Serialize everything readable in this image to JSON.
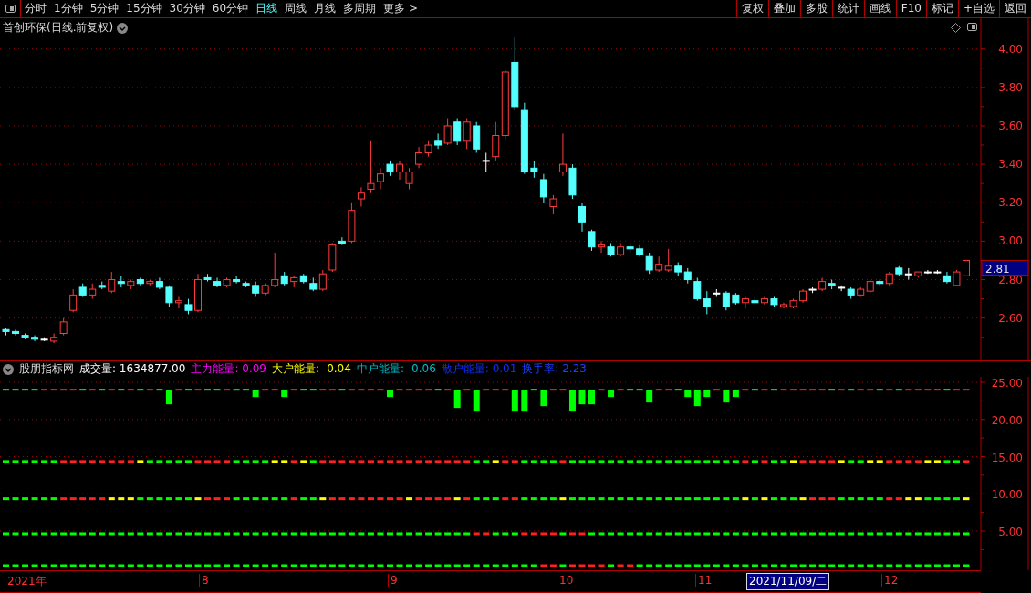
{
  "toolbar": {
    "periods": [
      {
        "label": "分时",
        "selected": false
      },
      {
        "label": "1分钟",
        "selected": false
      },
      {
        "label": "5分钟",
        "selected": false
      },
      {
        "label": "15分钟",
        "selected": false
      },
      {
        "label": "30分钟",
        "selected": false
      },
      {
        "label": "60分钟",
        "selected": false
      },
      {
        "label": "日线",
        "selected": true
      },
      {
        "label": "周线",
        "selected": false
      },
      {
        "label": "月线",
        "selected": false
      },
      {
        "label": "多周期",
        "selected": false
      }
    ],
    "more": "更多",
    "more_arrow": ">",
    "buttons": [
      "复权",
      "叠加",
      "多股",
      "统计",
      "画线",
      "F10",
      "标记",
      "+自选",
      "返回"
    ]
  },
  "main_chart": {
    "title": "首创环保(日线.前复权)",
    "price_tag": "2.81",
    "chart_data": {
      "type": "candlestick",
      "grid": true,
      "ylim": [
        2.38,
        4.16
      ],
      "yticks": [
        {
          "value": 4.0,
          "label": "4.00"
        },
        {
          "value": 3.8,
          "label": "3.80"
        },
        {
          "value": 3.6,
          "label": "3.60"
        },
        {
          "value": 3.4,
          "label": "3.40"
        },
        {
          "value": 3.2,
          "label": "3.20"
        },
        {
          "value": 3.0,
          "label": "3.00"
        },
        {
          "value": 2.8,
          "label": "2.80"
        },
        {
          "value": 2.6,
          "label": "2.60"
        }
      ],
      "ohlc": [
        [
          2.54,
          2.55,
          2.51,
          2.53
        ],
        [
          2.53,
          2.54,
          2.51,
          2.52
        ],
        [
          2.51,
          2.52,
          2.49,
          2.5
        ],
        [
          2.5,
          2.51,
          2.48,
          2.49
        ],
        [
          2.49,
          2.5,
          2.48,
          2.49
        ],
        [
          2.48,
          2.52,
          2.47,
          2.5
        ],
        [
          2.52,
          2.6,
          2.51,
          2.58
        ],
        [
          2.64,
          2.75,
          2.63,
          2.72
        ],
        [
          2.76,
          2.78,
          2.71,
          2.72
        ],
        [
          2.72,
          2.78,
          2.7,
          2.75
        ],
        [
          2.77,
          2.79,
          2.75,
          2.76
        ],
        [
          2.74,
          2.84,
          2.73,
          2.8
        ],
        [
          2.79,
          2.82,
          2.76,
          2.78
        ],
        [
          2.77,
          2.8,
          2.75,
          2.79
        ],
        [
          2.8,
          2.81,
          2.77,
          2.78
        ],
        [
          2.78,
          2.8,
          2.77,
          2.79
        ],
        [
          2.79,
          2.81,
          2.75,
          2.76
        ],
        [
          2.76,
          2.77,
          2.66,
          2.68
        ],
        [
          2.68,
          2.71,
          2.65,
          2.69
        ],
        [
          2.67,
          2.7,
          2.62,
          2.64
        ],
        [
          2.64,
          2.83,
          2.63,
          2.8
        ],
        [
          2.81,
          2.83,
          2.79,
          2.8
        ],
        [
          2.79,
          2.81,
          2.76,
          2.77
        ],
        [
          2.77,
          2.81,
          2.76,
          2.8
        ],
        [
          2.8,
          2.82,
          2.78,
          2.79
        ],
        [
          2.78,
          2.79,
          2.76,
          2.77
        ],
        [
          2.77,
          2.79,
          2.71,
          2.73
        ],
        [
          2.73,
          2.78,
          2.72,
          2.77
        ],
        [
          2.77,
          2.94,
          2.76,
          2.8
        ],
        [
          2.82,
          2.84,
          2.77,
          2.78
        ],
        [
          2.79,
          2.82,
          2.76,
          2.81
        ],
        [
          2.82,
          2.83,
          2.78,
          2.79
        ],
        [
          2.78,
          2.81,
          2.74,
          2.75
        ],
        [
          2.75,
          2.85,
          2.74,
          2.83
        ],
        [
          2.85,
          2.99,
          2.84,
          2.98
        ],
        [
          3.0,
          3.02,
          2.98,
          2.99
        ],
        [
          3.0,
          3.2,
          2.99,
          3.16
        ],
        [
          3.22,
          3.28,
          3.18,
          3.25
        ],
        [
          3.27,
          3.52,
          3.25,
          3.3
        ],
        [
          3.31,
          3.38,
          3.27,
          3.35
        ],
        [
          3.4,
          3.42,
          3.34,
          3.36
        ],
        [
          3.36,
          3.42,
          3.32,
          3.4
        ],
        [
          3.3,
          3.38,
          3.27,
          3.36
        ],
        [
          3.4,
          3.49,
          3.38,
          3.46
        ],
        [
          3.46,
          3.52,
          3.44,
          3.5
        ],
        [
          3.52,
          3.56,
          3.48,
          3.5
        ],
        [
          3.51,
          3.64,
          3.5,
          3.6
        ],
        [
          3.62,
          3.64,
          3.5,
          3.52
        ],
        [
          3.52,
          3.64,
          3.48,
          3.62
        ],
        [
          3.6,
          3.62,
          3.46,
          3.48
        ],
        [
          3.42,
          3.46,
          3.36,
          3.42
        ],
        [
          3.44,
          3.62,
          3.42,
          3.55
        ],
        [
          3.55,
          3.89,
          3.53,
          3.88
        ],
        [
          3.93,
          4.06,
          3.68,
          3.7
        ],
        [
          3.68,
          3.72,
          3.35,
          3.36
        ],
        [
          3.38,
          3.42,
          3.33,
          3.36
        ],
        [
          3.32,
          3.35,
          3.2,
          3.23
        ],
        [
          3.18,
          3.24,
          3.14,
          3.22
        ],
        [
          3.36,
          3.56,
          3.34,
          3.4
        ],
        [
          3.38,
          3.4,
          3.22,
          3.24
        ],
        [
          3.18,
          3.2,
          3.05,
          3.1
        ],
        [
          3.05,
          3.06,
          2.95,
          2.97
        ],
        [
          2.97,
          3.0,
          2.94,
          2.98
        ],
        [
          2.97,
          2.99,
          2.92,
          2.93
        ],
        [
          2.93,
          2.99,
          2.92,
          2.97
        ],
        [
          2.97,
          2.99,
          2.94,
          2.96
        ],
        [
          2.96,
          2.98,
          2.92,
          2.93
        ],
        [
          2.92,
          2.94,
          2.83,
          2.85
        ],
        [
          2.85,
          2.92,
          2.84,
          2.88
        ],
        [
          2.85,
          2.96,
          2.84,
          2.87
        ],
        [
          2.87,
          2.89,
          2.82,
          2.84
        ],
        [
          2.84,
          2.86,
          2.78,
          2.8
        ],
        [
          2.79,
          2.81,
          2.69,
          2.7
        ],
        [
          2.7,
          2.74,
          2.62,
          2.66
        ],
        [
          2.73,
          2.75,
          2.71,
          2.73
        ],
        [
          2.73,
          2.74,
          2.64,
          2.66
        ],
        [
          2.72,
          2.73,
          2.67,
          2.68
        ],
        [
          2.68,
          2.71,
          2.65,
          2.7
        ],
        [
          2.69,
          2.71,
          2.67,
          2.68
        ],
        [
          2.68,
          2.71,
          2.67,
          2.7
        ],
        [
          2.7,
          2.71,
          2.66,
          2.67
        ],
        [
          2.66,
          2.68,
          2.65,
          2.67
        ],
        [
          2.66,
          2.7,
          2.65,
          2.69
        ],
        [
          2.69,
          2.75,
          2.68,
          2.74
        ],
        [
          2.75,
          2.76,
          2.73,
          2.75
        ],
        [
          2.75,
          2.81,
          2.74,
          2.79
        ],
        [
          2.78,
          2.8,
          2.75,
          2.77
        ],
        [
          2.76,
          2.77,
          2.74,
          2.76
        ],
        [
          2.75,
          2.76,
          2.7,
          2.72
        ],
        [
          2.72,
          2.76,
          2.71,
          2.75
        ],
        [
          2.74,
          2.8,
          2.73,
          2.79
        ],
        [
          2.79,
          2.8,
          2.77,
          2.78
        ],
        [
          2.78,
          2.84,
          2.77,
          2.83
        ],
        [
          2.86,
          2.87,
          2.82,
          2.83
        ],
        [
          2.83,
          2.86,
          2.8,
          2.83
        ],
        [
          2.82,
          2.84,
          2.81,
          2.84
        ],
        [
          2.84,
          2.85,
          2.83,
          2.84
        ],
        [
          2.84,
          2.85,
          2.83,
          2.84
        ],
        [
          2.82,
          2.84,
          2.78,
          2.79
        ],
        [
          2.77,
          2.85,
          2.77,
          2.84
        ],
        [
          2.82,
          2.9,
          2.82,
          2.9
        ]
      ]
    }
  },
  "indicator": {
    "name": "股朋指标网",
    "readings": [
      {
        "label": "成交量:",
        "value": "1634877.00",
        "color": "#ffffff"
      },
      {
        "label": "主力能量:",
        "value": "0.09",
        "color": "#ff00ff"
      },
      {
        "label": "大户能量:",
        "value": "-0.04",
        "color": "#ffff00"
      },
      {
        "label": "中户能量:",
        "value": "-0.06",
        "color": "#00b8c8"
      },
      {
        "label": "散户能量:",
        "value": "0.01",
        "color": "#1030ff"
      },
      {
        "label": "换手率:",
        "value": "2.23",
        "color": "#1840ff"
      }
    ],
    "yticks": [
      "25.00",
      "20.00",
      "15.00",
      "10.00",
      "5.00"
    ]
  },
  "time_axis": {
    "labels": [
      "2021年",
      "8",
      "9",
      "10",
      "11"
    ],
    "cursor_date": "2021/11/09/二",
    "last_label": "12"
  }
}
